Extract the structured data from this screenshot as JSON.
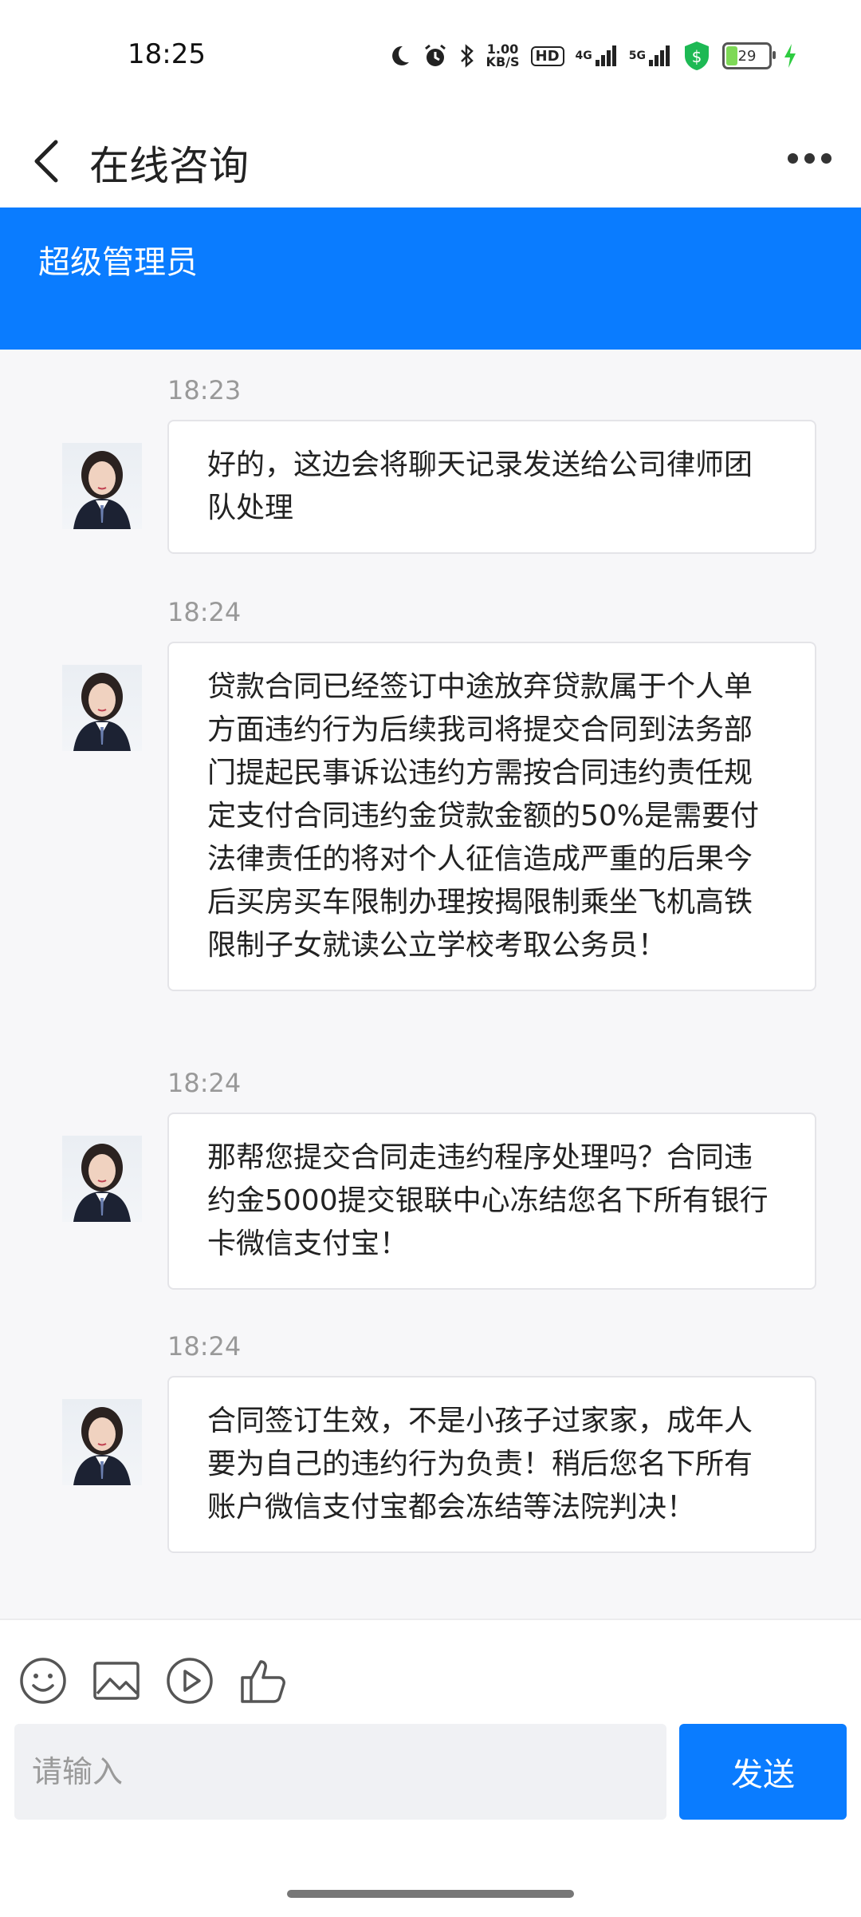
{
  "status_bar": {
    "time": "18:25",
    "net_speed_value": "1.00",
    "net_speed_unit": "KB/S",
    "hd_label": "HD",
    "sim1_label": "4G",
    "sim2_label": "5G",
    "battery": "29",
    "icons": [
      "moon-icon",
      "alarm-icon",
      "bluetooth-icon",
      "signal-icon",
      "shield-icon",
      "battery-icon",
      "charging-icon"
    ]
  },
  "header": {
    "title": "在线咨询"
  },
  "banner": {
    "title": "超级管理员"
  },
  "messages": [
    {
      "time": "18:23",
      "text": "好的，这边会将聊天记录发送给公司律师团队处理"
    },
    {
      "time": "18:24",
      "text": "贷款合同已经签订中途放弃贷款属于个人单方面违约行为后续我司将提交合同到法务部门提起民事诉讼违约方需按合同违约责任规定支付合同违约金贷款金额的50%是需要付法律责任的将对个人征信造成严重的后果今后买房买车限制办理按揭限制乘坐飞机高铁限制子女就读公立学校考取公务员！"
    },
    {
      "time": "18:24",
      "text": "那帮您提交合同走违约程序处理吗？合同违约金5000提交银联中心冻结您名下所有银行卡微信支付宝！"
    },
    {
      "time": "18:24",
      "text": "合同签订生效，不是小孩子过家家，成年人要为自己的违约行为负责！稍后您名下所有账户微信支付宝都会冻结等法院判决！"
    }
  ],
  "toolbar": {
    "tools": [
      "emoji-icon",
      "image-icon",
      "video-icon",
      "thumbs-up-icon"
    ]
  },
  "composer": {
    "placeholder": "请输入",
    "send_label": "发送"
  },
  "colors": {
    "accent": "#0a7cff",
    "background": "#f7f7f9"
  }
}
